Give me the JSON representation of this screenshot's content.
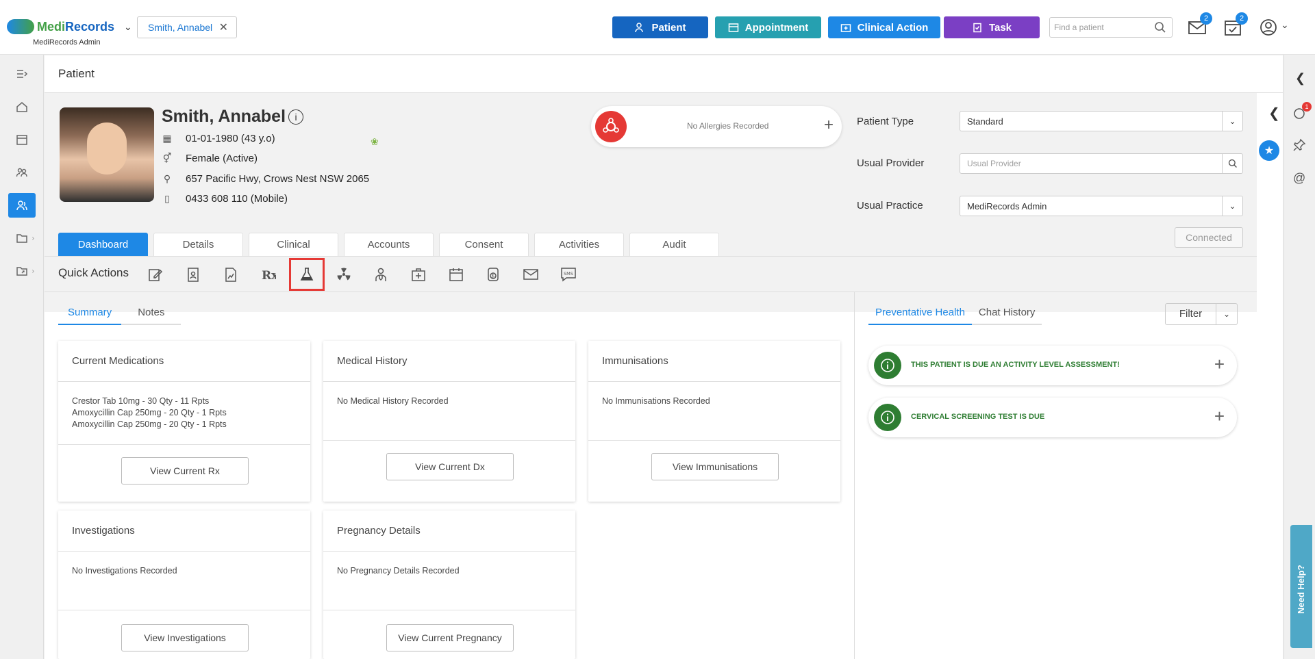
{
  "app": {
    "brand_part1": "Medi",
    "brand_part2": "Records",
    "practice": "MediRecords Admin"
  },
  "patient_tag": {
    "name": "Smith, Annabel"
  },
  "top_buttons": [
    {
      "label": "Patient",
      "color": "#1565c0"
    },
    {
      "label": "Appointment",
      "color": "#26a0b0"
    },
    {
      "label": "Clinical Action",
      "color": "#1e88e5"
    },
    {
      "label": "Task",
      "color": "#7b3fc4"
    }
  ],
  "search": {
    "placeholder": "Find a patient"
  },
  "badges": {
    "mail": "2",
    "tasks": "2",
    "chat": "1"
  },
  "page": {
    "title": "Patient"
  },
  "patient": {
    "name": "Smith, Annabel",
    "dob": "01-01-1980 (43 y.o)",
    "gender": "Female (Active)",
    "address": "657 Pacific Hwy, Crows Nest NSW 2065",
    "phone": "0433 608 110 (Mobile)"
  },
  "allergy": {
    "text": "No Allergies Recorded"
  },
  "fields": {
    "patient_type_label": "Patient Type",
    "patient_type_value": "Standard",
    "usual_provider_label": "Usual Provider",
    "usual_provider_placeholder": "Usual Provider",
    "usual_practice_label": "Usual Practice",
    "usual_practice_value": "MediRecords Admin",
    "connected": "Connected"
  },
  "tabs": [
    "Dashboard",
    "Details",
    "Clinical",
    "Accounts",
    "Consent",
    "Activities",
    "Audit"
  ],
  "quick_actions": {
    "label": "Quick Actions",
    "icons": [
      "edit-note-icon",
      "id-badge-icon",
      "document-chart-icon",
      "rx-icon",
      "lab-flask-icon",
      "radiation-icon",
      "doctor-icon",
      "medical-kit-icon",
      "calendar-icon",
      "billing-icon",
      "mail-icon",
      "sms-icon"
    ]
  },
  "subtabs": [
    "Summary",
    "Notes"
  ],
  "cards": {
    "medications": {
      "title": "Current Medications",
      "items": [
        "Crestor Tab 10mg - 30 Qty - 11 Rpts",
        "Amoxycillin Cap 250mg - 20 Qty - 1 Rpts",
        "Amoxycillin Cap 250mg - 20 Qty - 1 Rpts"
      ],
      "button": "View Current Rx"
    },
    "history": {
      "title": "Medical History",
      "text": "No Medical History Recorded",
      "button": "View Current Dx"
    },
    "immunisations": {
      "title": "Immunisations",
      "text": "No Immunisations Recorded",
      "button": "View Immunisations"
    },
    "investigations": {
      "title": "Investigations",
      "text": "No Investigations Recorded",
      "button": "View Investigations"
    },
    "pregnancy": {
      "title": "Pregnancy Details",
      "text": "No Pregnancy Details Recorded",
      "button": "View Current Pregnancy"
    }
  },
  "right_tabs": [
    "Preventative Health",
    "Chat History"
  ],
  "filter": {
    "label": "Filter"
  },
  "alerts": [
    "THIS PATIENT IS DUE AN ACTIVITY LEVEL ASSESSMENT!",
    "CERVICAL SCREENING TEST IS DUE"
  ],
  "need_help": "Need Help?"
}
